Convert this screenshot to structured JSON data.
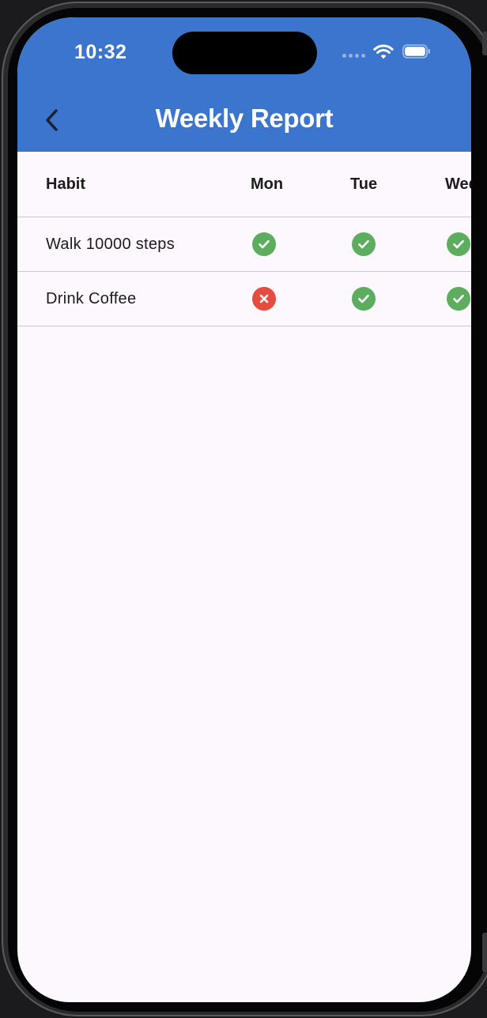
{
  "status_bar": {
    "time": "10:32"
  },
  "app_bar": {
    "title": "Weekly Report",
    "back_icon": "chevron-left-icon",
    "background_color": "#3b75cd"
  },
  "table": {
    "columns": [
      "Habit",
      "Mon",
      "Tue",
      "Wed"
    ],
    "rows": [
      {
        "habit": "Walk 10000 steps",
        "days": [
          "done",
          "done",
          "done"
        ]
      },
      {
        "habit": "Drink Coffee",
        "days": [
          "missed",
          "done",
          "done"
        ]
      }
    ]
  },
  "status_icons": {
    "done": "check-circle-icon",
    "missed": "x-circle-icon",
    "done_color": "#5cad5d",
    "missed_color": "#e54c3f"
  }
}
